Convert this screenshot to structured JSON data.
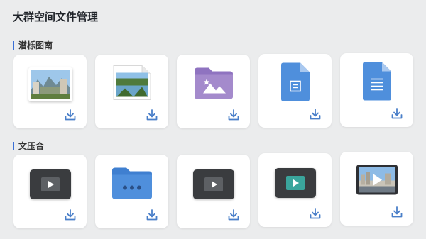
{
  "header": {
    "title": "大群空间文件管理"
  },
  "sections": [
    {
      "label": "潜栎图南",
      "items": [
        {
          "type": "photo-image",
          "icon": "landscape-photo-icon"
        },
        {
          "type": "photo-image-dogear",
          "icon": "river-photo-icon"
        },
        {
          "type": "image-folder",
          "icon": "purple-image-folder-icon",
          "color": "#9b7fc7"
        },
        {
          "type": "document",
          "icon": "blue-document-icon",
          "color": "#4f8fdc"
        },
        {
          "type": "document-lines",
          "icon": "blue-document-lines-icon",
          "color": "#4f8fdc"
        }
      ]
    },
    {
      "label": "文压合",
      "items": [
        {
          "type": "video",
          "icon": "dark-video-icon"
        },
        {
          "type": "folder",
          "icon": "blue-folder-icon",
          "color": "#4f8fdc"
        },
        {
          "type": "video",
          "icon": "dark-video-icon"
        },
        {
          "type": "video-teal",
          "icon": "teal-video-icon",
          "color": "#3aa59c"
        },
        {
          "type": "video-photo",
          "icon": "city-video-icon"
        }
      ]
    }
  ],
  "colors": {
    "accent": "#3a6fd6",
    "download": "#4a7fc9"
  }
}
